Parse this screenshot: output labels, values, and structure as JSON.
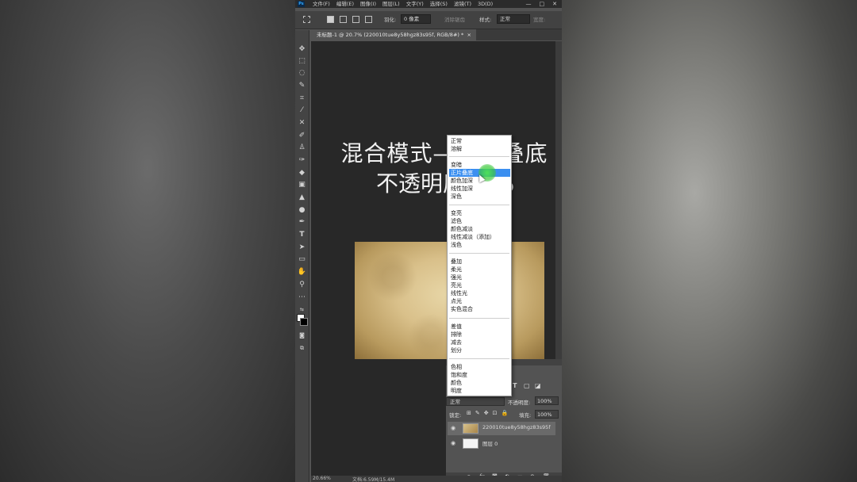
{
  "app": {
    "logo": "Ps"
  },
  "menu": [
    "文件(F)",
    "编辑(E)",
    "图像(I)",
    "图层(L)",
    "文字(Y)",
    "选择(S)",
    "滤镜(T)",
    "3D(D)"
  ],
  "window_controls": {
    "minimize": "—",
    "maximize": "□",
    "close": "✕"
  },
  "options": {
    "feather_label": "羽化:",
    "feather_value": "0 像素",
    "antialias_label": "消除锯齿",
    "style_label": "样式:",
    "style_value": "正常",
    "more_label": "宽度:"
  },
  "document_tab": {
    "title": "未标题-1 @ 20.7% (220010tue8y58hgz83s95f, RGB/8#) *",
    "close": "×"
  },
  "canvas": {
    "title_line1": "混合模式—正片叠底",
    "title_line2": "不透明度75%"
  },
  "blend_menu": {
    "groups": [
      [
        "正常",
        "溶解"
      ],
      [
        "变暗",
        "正片叠底",
        "颜色加深",
        "线性加深",
        "深色"
      ],
      [
        "变亮",
        "滤色",
        "颜色减淡",
        "线性减淡（添加）",
        "浅色"
      ],
      [
        "叠加",
        "柔光",
        "强光",
        "亮光",
        "线性光",
        "点光",
        "实色混合"
      ],
      [
        "差值",
        "排除",
        "减去",
        "划分"
      ],
      [
        "色相",
        "饱和度",
        "颜色",
        "明度"
      ]
    ],
    "selected": "正片叠底"
  },
  "layers_panel": {
    "blend_mode": "正常",
    "opacity_label": "不透明度:",
    "opacity_value": "100%",
    "lock_label": "锁定:",
    "fill_label": "填充:",
    "fill_value": "100%",
    "layers": [
      {
        "name": "220010tue8y58hgz83s95f",
        "visible": true
      },
      {
        "name": "图层 0",
        "visible": true
      }
    ]
  },
  "status": {
    "zoom": "20.66%",
    "doc": "文档:6.59M/15.4M"
  }
}
